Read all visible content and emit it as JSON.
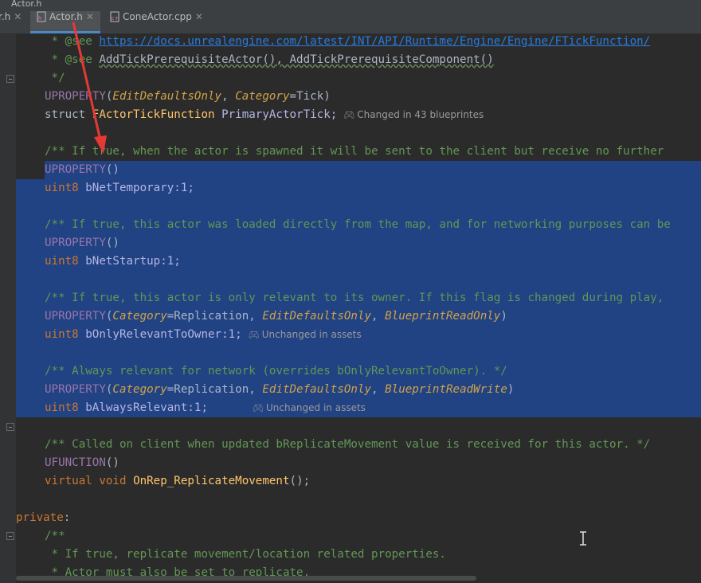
{
  "window": {
    "title": "Actor.h"
  },
  "tabs": [
    {
      "name": "r.h",
      "active": false
    },
    {
      "name": "Actor.h",
      "active": true
    },
    {
      "name": "ConeActor.cpp",
      "active": false
    }
  ],
  "hints": {
    "primary_tick": "Changed in 43 blueprintes",
    "only_relevant": "Unchanged in assets",
    "always_relevant": "Unchanged in assets"
  },
  "code": {
    "see1_prefix": " * @see ",
    "see1_url": "https://docs.unrealengine.com/latest/INT/API/Runtime/Engine/Engine/FTickFunction/",
    "see2_prefix": " * @see ",
    "see2_text": "AddTickPrerequisiteActor(), AddTickPrerequisiteComponent()",
    "doc_end": " */",
    "uprop": "UPROPERTY",
    "edit_defaults_only": "EditDefaultsOnly",
    "category": "Category",
    "tick_value": "=Tick)",
    "struct_kw": "struct",
    "ftick_type": "FActorTickFunction",
    "primary_tick": "PrimaryActorTick;",
    "net_temp_comment": "/** If true, when the actor is spawned it will be sent to the client but receive no further",
    "uint8": "uint8",
    "net_temp": "bNetTemporary:1;",
    "net_startup_comment": "/** If true, this actor was loaded directly from the map, and for networking purposes can be",
    "net_startup": "bNetStartup:1;",
    "only_relevant_comment": "/** If true, this actor is only relevant to its owner. If this flag is changed during play,",
    "replication": "=Replication, ",
    "blueprint_readonly": "BlueprintReadOnly",
    "only_relevant": "bOnlyRelevantToOwner:1;",
    "always_relevant_comment": "/** Always relevant for network (overrides bOnlyRelevantToOwner). */",
    "blueprint_readwrite": "BlueprintReadWrite",
    "always_relevant": "bAlwaysRelevant:1;",
    "replicate_comment": "/** Called on client when updated bReplicateMovement value is received for this actor. */",
    "ufunction": "UFUNCTION",
    "virtual_kw": "virtual",
    "void_kw": "void",
    "onrep": "OnRep_ReplicateMovement",
    "onrep_tail": "();",
    "private_kw": "private",
    "doc_open": "/**",
    "doc_line1": " * If true, replicate movement/location related properties.",
    "doc_line2": " * Actor must also be set to replicate."
  },
  "colors": {
    "editor_bg": "#2b2b2b",
    "selection": "#214283",
    "annotation_arrow": "#e53935"
  }
}
